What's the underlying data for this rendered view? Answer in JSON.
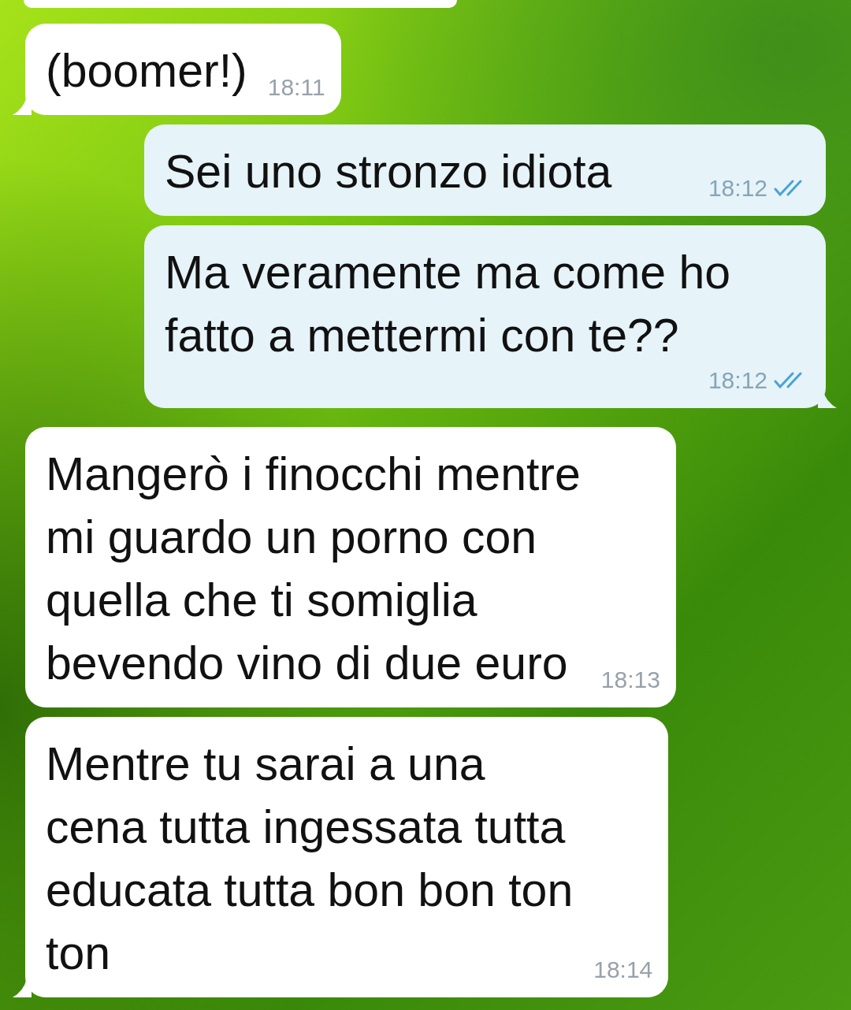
{
  "messages": [
    {
      "kind": "incoming",
      "text": "(boomer!)",
      "time": "18:11",
      "tail": true
    },
    {
      "kind": "outgoing",
      "text": "Sei uno stronzo idiota",
      "time": "18:12",
      "read": true,
      "tail": false
    },
    {
      "kind": "outgoing",
      "text": "Ma veramente ma come ho\nfatto a mettermi con te??",
      "time": "18:12",
      "read": true,
      "tail": true
    },
    {
      "kind": "incoming",
      "text": "Mangerò i finocchi mentre\nmi guardo un porno con\nquella che ti somiglia\nbevendo vino di due euro",
      "time": "18:13",
      "tail": false
    },
    {
      "kind": "incoming",
      "text": "Mentre tu sarai a una\ncena tutta ingessata tutta\neducata tutta bon bon ton\nton",
      "time": "18:14",
      "tail": true
    }
  ]
}
